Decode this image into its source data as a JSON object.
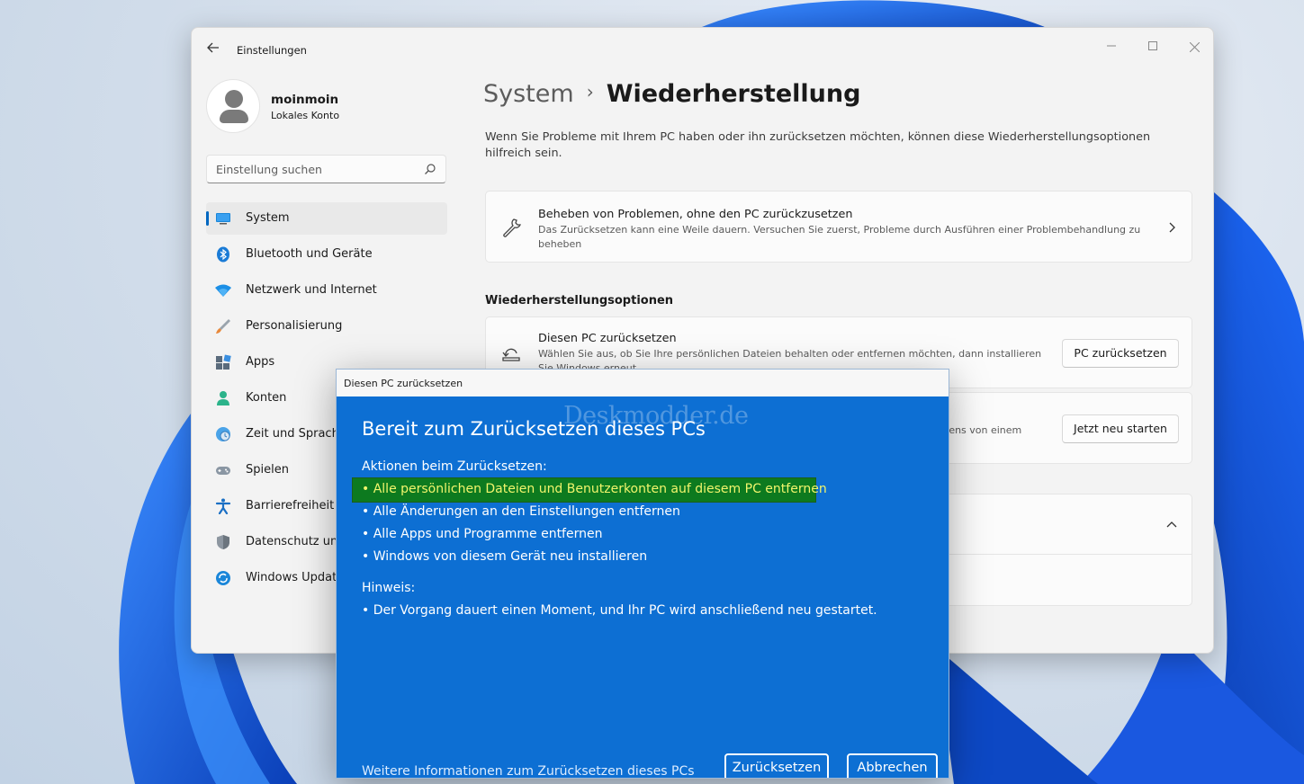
{
  "window": {
    "title": "Einstellungen",
    "back_icon": "arrow-left-icon",
    "controls": [
      "minimize-icon",
      "maximize-icon",
      "close-icon"
    ]
  },
  "profile": {
    "name": "moinmoin",
    "account_type": "Lokales Konto"
  },
  "search": {
    "placeholder": "Einstellung suchen",
    "icon": "search-icon"
  },
  "sidebar": {
    "items": [
      {
        "label": "System",
        "icon": "system-monitor-icon",
        "active": true
      },
      {
        "label": "Bluetooth und Geräte",
        "icon": "bluetooth-icon"
      },
      {
        "label": "Netzwerk und Internet",
        "icon": "wifi-icon"
      },
      {
        "label": "Personalisierung",
        "icon": "paintbrush-icon"
      },
      {
        "label": "Apps",
        "icon": "apps-icon"
      },
      {
        "label": "Konten",
        "icon": "person-icon"
      },
      {
        "label": "Zeit und Sprache",
        "icon": "clock-globe-icon"
      },
      {
        "label": "Spielen",
        "icon": "gamepad-icon"
      },
      {
        "label": "Barrierefreiheit",
        "icon": "accessibility-icon"
      },
      {
        "label": "Datenschutz und Sicherheit",
        "icon": "shield-icon"
      },
      {
        "label": "Windows Update",
        "icon": "update-icon"
      }
    ]
  },
  "main": {
    "breadcrumb_parent": "System",
    "breadcrumb_separator": "›",
    "breadcrumb_current": "Wiederherstellung",
    "intro": "Wenn Sie Probleme mit Ihrem PC haben oder ihn zurücksetzen möchten, können diese Wiederherstellungsoptionen hilfreich sein.",
    "troubleshoot_card": {
      "title": "Beheben von Problemen, ohne den PC zurückzusetzen",
      "description": "Das Zurücksetzen kann eine Weile dauern. Versuchen Sie zuerst, Probleme durch Ausführen einer Problembehandlung zu beheben",
      "icon": "wrench-icon"
    },
    "section_heading": "Wiederherstellungsoptionen",
    "reset_card": {
      "title": "Diesen PC zurücksetzen",
      "description": "Wählen Sie aus, ob Sie Ihre persönlichen Dateien behalten oder entfernen möchten, dann installieren Sie Windows erneut",
      "button": "PC zurücksetzen",
      "icon": "reset-pc-icon"
    },
    "advanced_card": {
      "description_fragment": "tens von einem",
      "button": "Jetzt neu starten"
    }
  },
  "dialog": {
    "title": "Diesen PC zurücksetzen",
    "watermark": "Deskmodder.de",
    "heading": "Bereit zum Zurücksetzen dieses PCs",
    "actions_label": "Aktionen beim Zurücksetzen:",
    "actions": [
      "• Alle persönlichen Dateien und Benutzerkonten auf diesem PC entfernen",
      "• Alle Änderungen an den Einstellungen entfernen",
      "• Alle Apps und Programme entfernen",
      "•  Windows von diesem Gerät neu installieren"
    ],
    "note_label": "Hinweis:",
    "note": "•  Der Vorgang dauert einen Moment, und Ihr PC wird anschließend neu gestartet.",
    "more_info_link": "Weitere Informationen zum Zurücksetzen dieses PCs",
    "reset_button": "Zurücksetzen",
    "cancel_button": "Abbrechen",
    "colors": {
      "background": "#0d6fd3",
      "highlight": "#0d7a1f",
      "highlight_text": "#f1f56c"
    }
  }
}
